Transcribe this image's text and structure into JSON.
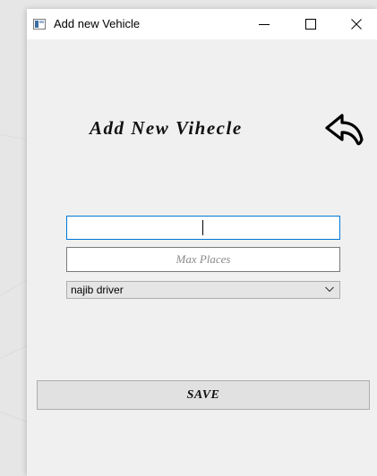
{
  "window": {
    "title": "Add new Vehicle",
    "icon": "app-window-icon",
    "controls": [
      "minimize-icon",
      "maximize-icon",
      "close-icon"
    ]
  },
  "form": {
    "heading": "Add New Vihecle",
    "back_icon": "back-arrow-icon",
    "name_input": {
      "value": "",
      "placeholder": ""
    },
    "max_places_input": {
      "value": "",
      "placeholder": "Max Places"
    },
    "driver_select": {
      "selected": "najib driver"
    },
    "save_label": "SAVE"
  },
  "colors": {
    "focus_border": "#0078d7",
    "window_bg": "#f0f0f0",
    "titlebar_bg": "#ffffff"
  }
}
